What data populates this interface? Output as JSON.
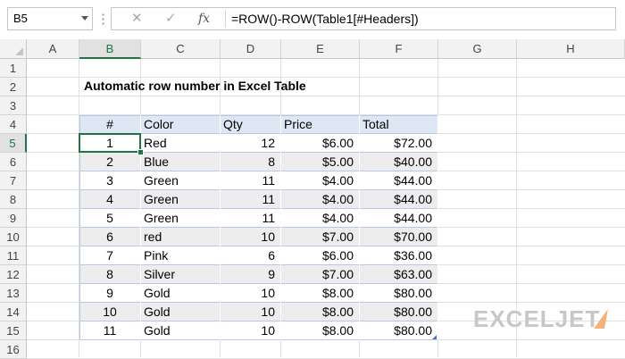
{
  "formula_bar": {
    "name_box": "B5",
    "formula": "=ROW()-ROW(Table1[#Headers])",
    "fx_label": "fx",
    "cancel_icon": "✕",
    "enter_icon": "✓"
  },
  "columns": [
    "A",
    "B",
    "C",
    "D",
    "E",
    "F",
    "G",
    "H"
  ],
  "rows": [
    "1",
    "2",
    "3",
    "4",
    "5",
    "6",
    "7",
    "8",
    "9",
    "10",
    "11",
    "12",
    "13",
    "14",
    "15",
    "16"
  ],
  "selected": {
    "column": "B",
    "row": "5"
  },
  "sheet_title": "Automatic row number in Excel Table",
  "table": {
    "headers": [
      "#",
      "Color",
      "Qty",
      "Price",
      "Total"
    ],
    "rows": [
      [
        "1",
        "Red",
        "12",
        "$6.00",
        "$72.00"
      ],
      [
        "2",
        "Blue",
        "8",
        "$5.00",
        "$40.00"
      ],
      [
        "3",
        "Green",
        "11",
        "$4.00",
        "$44.00"
      ],
      [
        "4",
        "Green",
        "11",
        "$4.00",
        "$44.00"
      ],
      [
        "5",
        "Green",
        "11",
        "$4.00",
        "$44.00"
      ],
      [
        "6",
        "red",
        "10",
        "$7.00",
        "$70.00"
      ],
      [
        "7",
        "Pink",
        "6",
        "$6.00",
        "$36.00"
      ],
      [
        "8",
        "Silver",
        "9",
        "$7.00",
        "$63.00"
      ],
      [
        "9",
        "Gold",
        "10",
        "$8.00",
        "$80.00"
      ],
      [
        "10",
        "Gold",
        "10",
        "$8.00",
        "$80.00"
      ],
      [
        "11",
        "Gold",
        "10",
        "$8.00",
        "$80.00"
      ]
    ]
  },
  "logo": {
    "text": "EXCELJET"
  },
  "colors": {
    "accent": "#217346",
    "table_header": "#dde8f4",
    "band": "#ededed"
  }
}
